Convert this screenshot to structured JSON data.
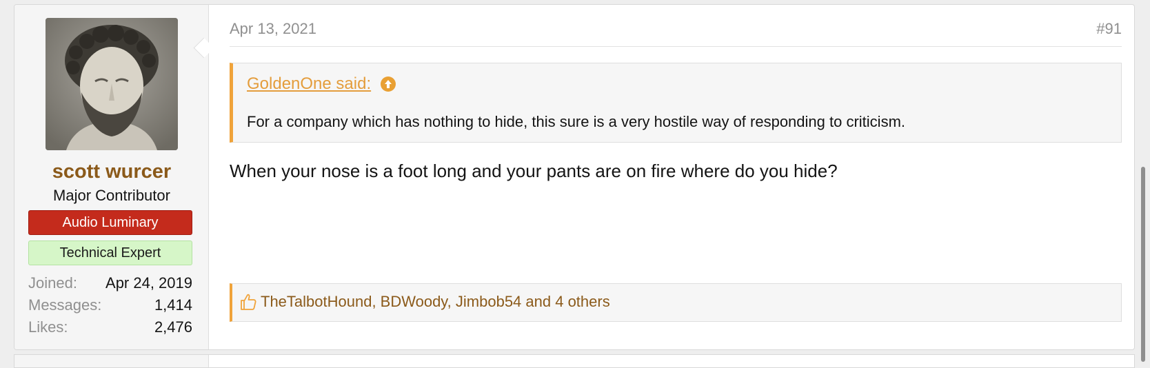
{
  "post": {
    "user": {
      "name": "scott wurcer",
      "title": "Major Contributor",
      "banners": [
        "Audio Luminary",
        "Technical Expert"
      ],
      "stats": [
        {
          "label": "Joined:",
          "value": "Apr 24, 2019"
        },
        {
          "label": "Messages:",
          "value": "1,414"
        },
        {
          "label": "Likes:",
          "value": "2,476"
        }
      ]
    },
    "date": "Apr 13, 2021",
    "number": "#91",
    "quote": {
      "attribution": "GoldenOne said:",
      "text": "For a company which has nothing to hide, this sure is a very hostile way of responding to criticism."
    },
    "message": "When your nose is a foot long and your pants are on fire where do you hide?",
    "likes": "TheTalbotHound, BDWoody, Jimbob54 and 4 others"
  },
  "colors": {
    "username": "#8b5a1a",
    "accent": "#f0a33a",
    "banner_red": "#c42b1c",
    "banner_green": "#d6f6c8"
  },
  "icons": [
    "arrow-up-circle-icon",
    "thumbs-up-icon"
  ]
}
